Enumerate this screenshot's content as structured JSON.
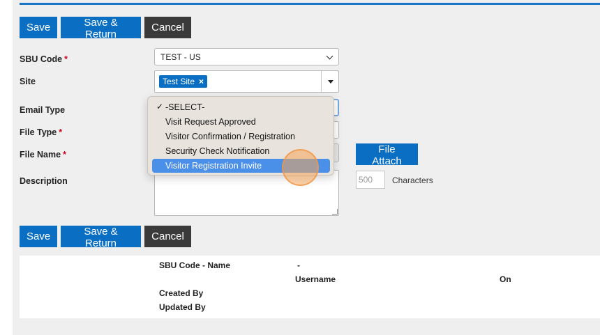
{
  "toolbar": {
    "save": "Save",
    "save_return": "Save & Return",
    "cancel": "Cancel"
  },
  "form": {
    "sbu_code": {
      "label": "SBU Code",
      "required": "*",
      "value": "TEST - US"
    },
    "site": {
      "label": "Site",
      "tag": "Test Site",
      "tag_remove": "×"
    },
    "email_type": {
      "label": "Email Type"
    },
    "file_type": {
      "label": "File Type",
      "required": "*"
    },
    "file_name": {
      "label": "File Name",
      "required": "*",
      "attach": "File Attach"
    },
    "description": {
      "label": "Description",
      "max": "500",
      "chars_label": "Characters"
    }
  },
  "dropdown": {
    "options": [
      {
        "label": "-SELECT-",
        "checked": true
      },
      {
        "label": "Visit Request Approved"
      },
      {
        "label": "Visitor Confirmation / Registration"
      },
      {
        "label": "Security Check Notification"
      },
      {
        "label": "Visitor Registration Invite",
        "highlighted": true
      }
    ],
    "checkmark": "✓"
  },
  "info": {
    "sbu_code_name": "SBU Code - Name",
    "dash": "-",
    "username": "Username",
    "on": "On",
    "created_by": "Created By",
    "updated_by": "Updated By"
  },
  "colors": {
    "accent": "#0a6fc2",
    "dark_button": "#3a3a3a",
    "highlight": "#4a90e8",
    "required": "#d0021b"
  }
}
